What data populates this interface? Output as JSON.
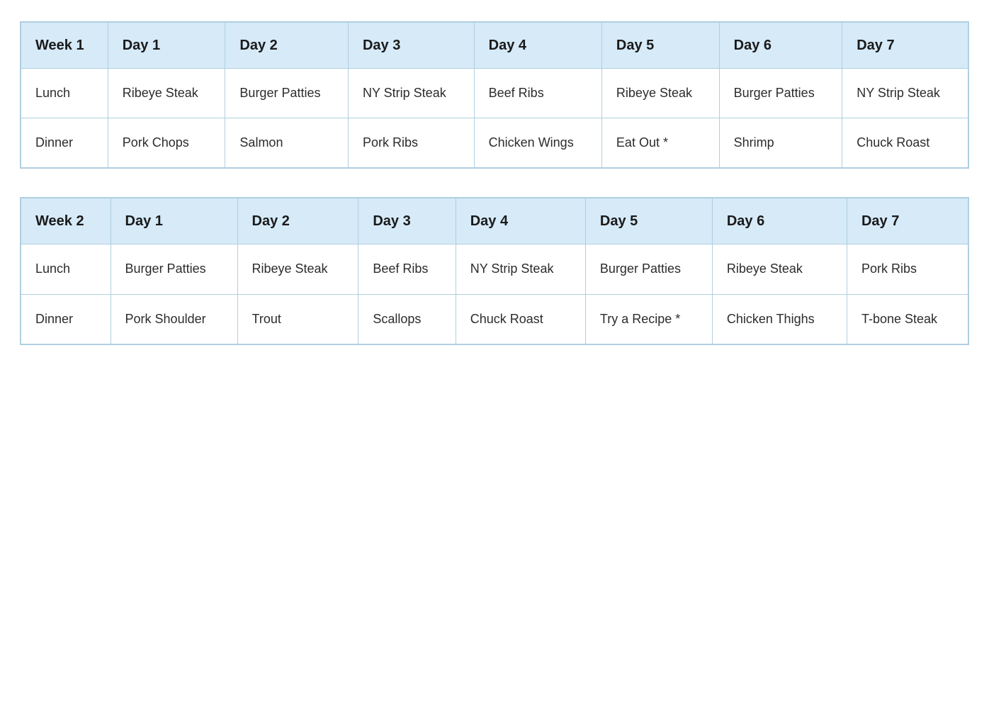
{
  "week1": {
    "header": {
      "week": "Week 1",
      "day1": "Day 1",
      "day2": "Day 2",
      "day3": "Day 3",
      "day4": "Day 4",
      "day5": "Day 5",
      "day6": "Day 6",
      "day7": "Day 7"
    },
    "rows": [
      {
        "meal": "Lunch",
        "day1": "Ribeye Steak",
        "day2": "Burger Patties",
        "day3": "NY Strip Steak",
        "day4": "Beef Ribs",
        "day5": "Ribeye Steak",
        "day6": "Burger Patties",
        "day7": "NY Strip Steak"
      },
      {
        "meal": "Dinner",
        "day1": "Pork Chops",
        "day2": "Salmon",
        "day3": "Pork Ribs",
        "day4": "Chicken Wings",
        "day5": "Eat Out *",
        "day6": "Shrimp",
        "day7": "Chuck Roast"
      }
    ]
  },
  "week2": {
    "header": {
      "week": "Week 2",
      "day1": "Day 1",
      "day2": "Day 2",
      "day3": "Day 3",
      "day4": "Day 4",
      "day5": "Day 5",
      "day6": "Day 6",
      "day7": "Day 7"
    },
    "rows": [
      {
        "meal": "Lunch",
        "day1": "Burger Patties",
        "day2": "Ribeye Steak",
        "day3": "Beef Ribs",
        "day4": "NY Strip Steak",
        "day5": "Burger Patties",
        "day6": "Ribeye Steak",
        "day7": "Pork Ribs"
      },
      {
        "meal": "Dinner",
        "day1": "Pork Shoulder",
        "day2": "Trout",
        "day3": "Scallops",
        "day4": "Chuck Roast",
        "day5": "Try a Recipe *",
        "day6": "Chicken Thighs",
        "day7": "T-bone Steak"
      }
    ]
  }
}
